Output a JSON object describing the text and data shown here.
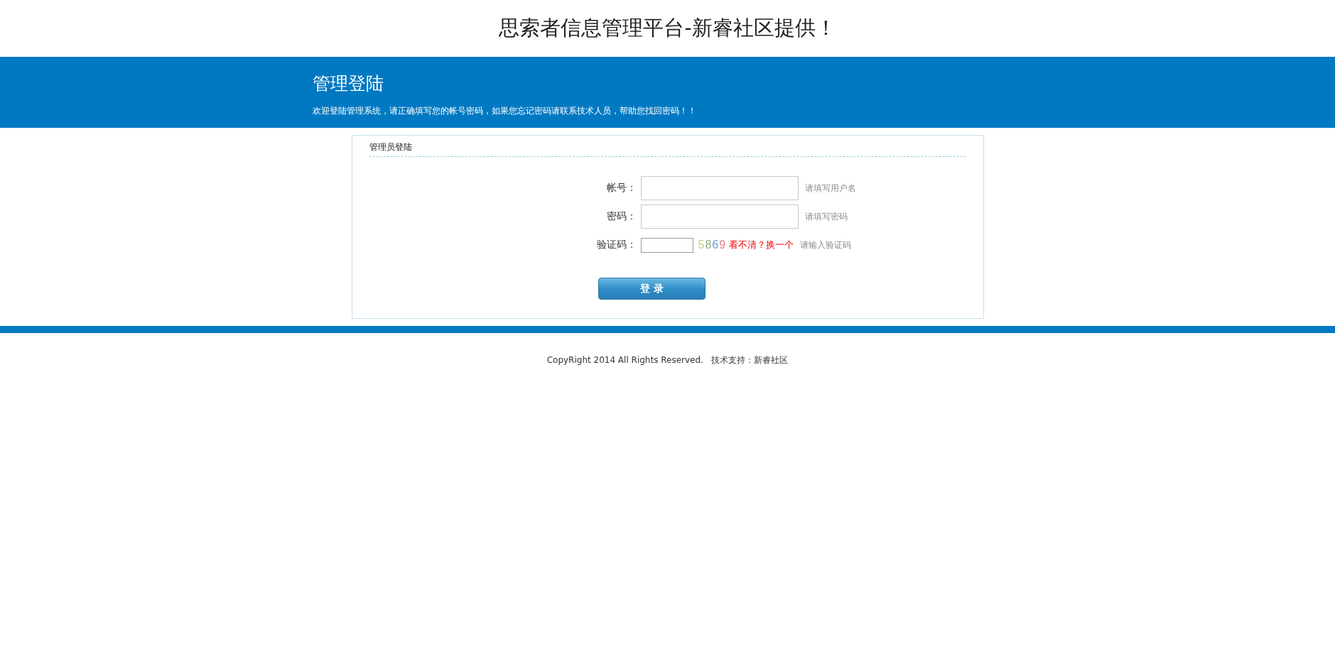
{
  "site_title": "思索者信息管理平台-新睿社区提供！",
  "banner": {
    "heading": "管理登陆",
    "notice": "欢迎登陆管理系统，请正确填写您的帐号密码，如果您忘记密码请联系技术人员，帮助您找回密码！！"
  },
  "login_panel": {
    "title": "管理员登陆",
    "fields": [
      {
        "kind": "text",
        "label": "帐号：",
        "hint": "请填写用户名"
      },
      {
        "kind": "password",
        "label": "密码：",
        "hint": "请填写密码"
      },
      {
        "kind": "captcha",
        "label": "验证码：",
        "hint": "请输入验证码",
        "refresh_link": "看不清？换一个",
        "captcha_digits": [
          {
            "text": "5",
            "color": "#c8d27a"
          },
          {
            "text": "8",
            "color": "#8aa882"
          },
          {
            "text": "6",
            "color": "#5aa6d6"
          },
          {
            "text": "9",
            "color": "#e6808a"
          }
        ]
      }
    ],
    "submit_button": "登 录"
  },
  "footer": "CopyRight 2014 All Rights Reserved.   技术支持：新睿社区"
}
